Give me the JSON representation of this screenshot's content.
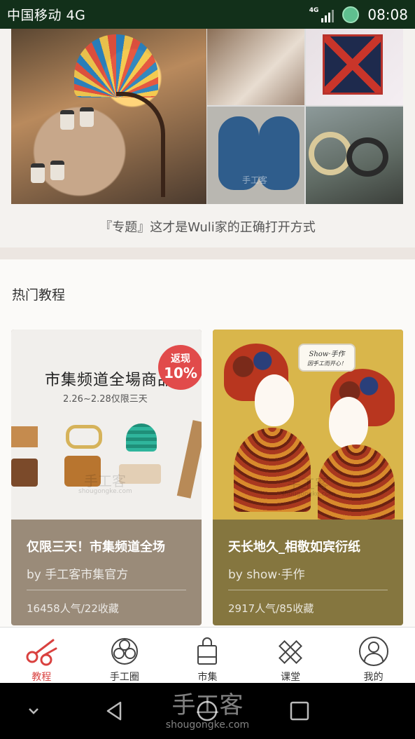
{
  "status_bar": {
    "carrier": "中国移动 4G",
    "network": "4G",
    "time": "08:08"
  },
  "feature": {
    "caption": "『专题』这才是Wuli家的正确打开方式"
  },
  "hot": {
    "title": "热门教程",
    "cards": [
      {
        "title": "仅限三天！市集频道全场",
        "author": "by 手工客市集官方",
        "stats": "16458人气/22收藏",
        "image_text": {
          "headline": "市集频道全場商品",
          "date": "2.26~2.28仅限三天",
          "badge_top": "返现",
          "badge_bottom": "10%",
          "watermark": "手工客",
          "watermark_sub": "shougongke.com"
        }
      },
      {
        "title": "天长地久_相敬如宾衍纸",
        "author": "by show·手作",
        "stats": "2917人气/85收藏",
        "image_text": {
          "bubble_line1": "Show·手作",
          "bubble_line2": "因手工而开心！",
          "watermark": "手工客",
          "watermark_sub": "shougongke.com"
        }
      }
    ]
  },
  "feature_watermark": "手工客",
  "bottom_nav": [
    {
      "label": "教程",
      "icon": "scissors-icon",
      "active": true
    },
    {
      "label": "手工圈",
      "icon": "flower-icon",
      "active": false
    },
    {
      "label": "市集",
      "icon": "shopping-bag-icon",
      "active": false
    },
    {
      "label": "课堂",
      "icon": "pencil-ruler-icon",
      "active": false
    },
    {
      "label": "我的",
      "icon": "user-icon",
      "active": false
    }
  ],
  "system_nav": {
    "watermark": "手工客",
    "watermark_sub": "shougongke.com"
  },
  "colors": {
    "status_bar": "#12301a",
    "accent": "#d9413f",
    "card_left": "#9a8b79",
    "card_right": "#85763f"
  }
}
